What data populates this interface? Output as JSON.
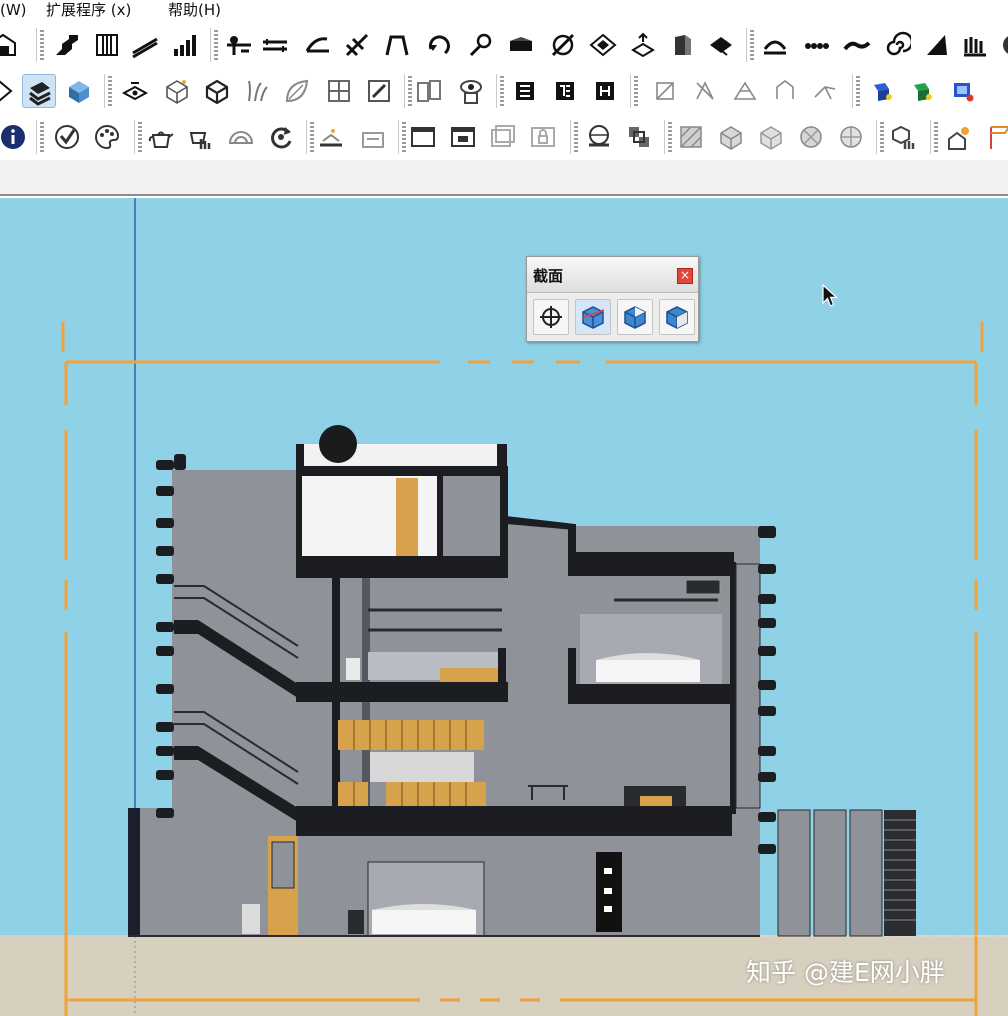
{
  "menu": {
    "items": [
      {
        "label": "(W)"
      },
      {
        "label": "扩展程序 (x)"
      },
      {
        "label": "帮助(H)"
      }
    ]
  },
  "toolbars": {
    "row1": [
      "warehouse-icon",
      "stairs-icon",
      "columns-icon",
      "ramp-icon",
      "bar-chart-icon",
      "node-link-icon",
      "dimension-line-icon",
      "bend-arrow-icon",
      "offset-icon",
      "arc-shape-icon",
      "rotate-icon",
      "hook-icon",
      "profile-icon",
      "pen-target-icon",
      "diamond-icon",
      "axis-cube-icon",
      "wall-icon",
      "landscape-icon",
      "arch-icon",
      "dots-icon",
      "curve-icon",
      "spiral-icon",
      "blade-icon",
      "comb-icon",
      "palette-icon"
    ],
    "row2": [
      "lasso-icon",
      "layers-icon",
      "solid-cube-icon",
      "section-plane-icon",
      "wire-cube-icon",
      "box-mesh-icon",
      "grass-icon",
      "leaf-icon",
      "grid-square-icon",
      "edit-square-icon",
      "split-box-icon",
      "eye-cursor-icon",
      "frame-a-icon",
      "frame-b-icon",
      "frame-c-icon",
      "triangle-a-icon",
      "triangle-b-icon",
      "triangle-c-icon",
      "triangle-d-icon",
      "arrow-fork-icon",
      "render-a-icon",
      "render-b-icon",
      "render-c-icon"
    ],
    "row3": [
      "info-icon",
      "check-circle-icon",
      "style-palette-icon",
      "teapot-icon",
      "hand-teapot-icon",
      "shell-icon",
      "refresh-icon",
      "terrain-flat-icon",
      "terrain-box-icon",
      "window-a-icon",
      "window-b-icon",
      "window-c-icon",
      "lock-box-icon",
      "sphere-icon",
      "stack-icon",
      "hatch-tile-icon",
      "cube-texture-a-icon",
      "cube-texture-b-icon",
      "ball-icon",
      "sphere-grid-icon",
      "hand-cube-icon",
      "sun-house-icon",
      "flag-icon"
    ]
  },
  "section_panel": {
    "title": "截面",
    "close_glyph": "×",
    "buttons": [
      "section-plane-tool-icon",
      "display-section-planes-icon",
      "display-section-cuts-icon",
      "display-section-fill-icon"
    ]
  },
  "watermark": "知乎 @建E网小胖",
  "colors": {
    "sky": "#8fd1e6",
    "ground": "#d7d0bf",
    "building": "#8f9298",
    "slab": "#1c1d20",
    "accent_orange": "#f1a23a",
    "wood": "#d6a34c",
    "active_blue": "#cfe3f7"
  }
}
